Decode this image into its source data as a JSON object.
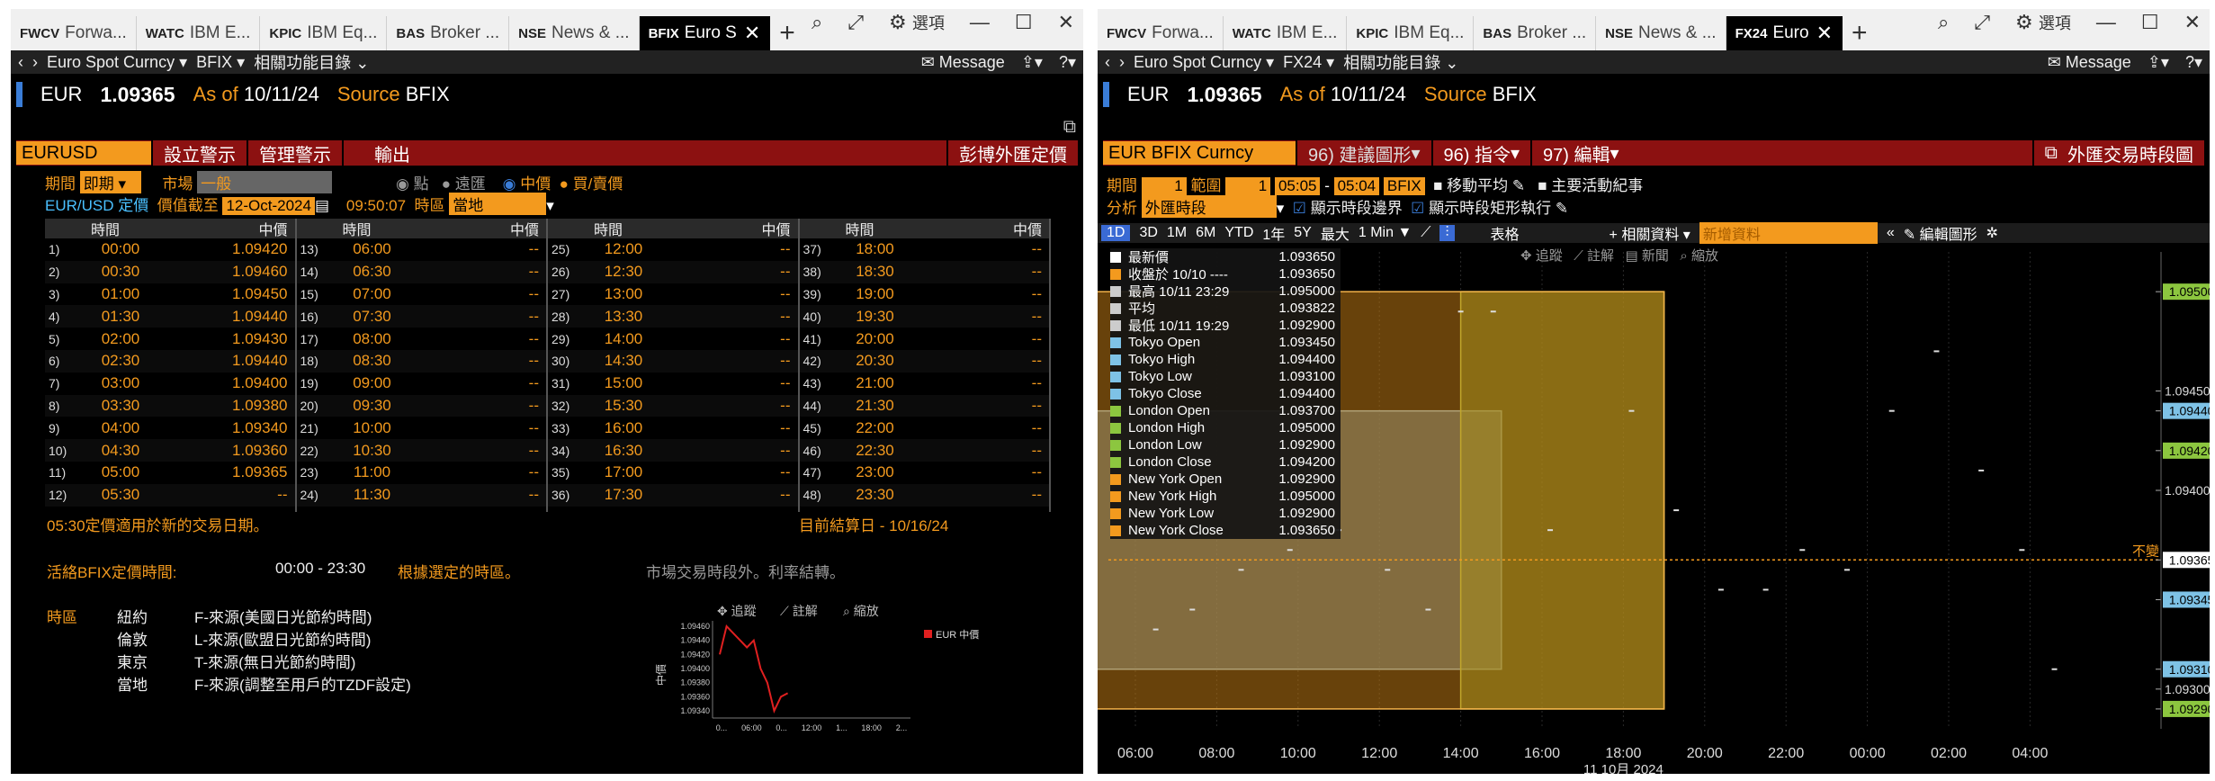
{
  "p1": {
    "tabs": [
      {
        "code": "FWCV",
        "name": "Forwa..."
      },
      {
        "code": "WATC",
        "name": "IBM E..."
      },
      {
        "code": "KPIC",
        "name": "IBM Eq..."
      },
      {
        "code": "BAS",
        "name": "Broker ..."
      },
      {
        "code": "NSE",
        "name": "News & ..."
      },
      {
        "code": "BFIX",
        "name": "Euro S"
      }
    ],
    "options_label": "選項",
    "nav": {
      "security": "Euro Spot Curncy",
      "func": "BFIX",
      "related": "相關功能目錄",
      "message": "Message"
    },
    "ticker": {
      "sym": "EUR",
      "price": "1.09365",
      "asof_label": "As of",
      "asof": "10/11/24",
      "source_label": "Source",
      "source": "BFIX"
    },
    "menu": {
      "sel": "EURUSD",
      "set_alert": "設立警示",
      "manage_alert": "管理警示",
      "export": "輸出",
      "title": "彭博外匯定價"
    },
    "ctrl": {
      "period_label": "期間",
      "period": "即期",
      "market_label": "市場",
      "market": "一般",
      "opt_spot": "點",
      "opt_far": "遠匯",
      "opt_mid": "中價",
      "opt_bidask": "買/賣價",
      "pair": "EUR/USD",
      "fix_label": "定價",
      "price_to_label": "價值截至",
      "date": "12-Oct-2024",
      "time": "09:50:07",
      "tz_label": "時區",
      "tz": "當地"
    },
    "cols": {
      "time": "時間",
      "mid": "中價"
    },
    "rows": [
      {
        "n": "1)",
        "t": "00:00",
        "v": "1.09420"
      },
      {
        "n": "2)",
        "t": "00:30",
        "v": "1.09460"
      },
      {
        "n": "3)",
        "t": "01:00",
        "v": "1.09450"
      },
      {
        "n": "4)",
        "t": "01:30",
        "v": "1.09440"
      },
      {
        "n": "5)",
        "t": "02:00",
        "v": "1.09430"
      },
      {
        "n": "6)",
        "t": "02:30",
        "v": "1.09440"
      },
      {
        "n": "7)",
        "t": "03:00",
        "v": "1.09400"
      },
      {
        "n": "8)",
        "t": "03:30",
        "v": "1.09380"
      },
      {
        "n": "9)",
        "t": "04:00",
        "v": "1.09340"
      },
      {
        "n": "10)",
        "t": "04:30",
        "v": "1.09360"
      },
      {
        "n": "11)",
        "t": "05:00",
        "v": "1.09365"
      },
      {
        "n": "12)",
        "t": "05:30",
        "v": "--"
      },
      {
        "n": "13)",
        "t": "06:00",
        "v": "--"
      },
      {
        "n": "14)",
        "t": "06:30",
        "v": "--"
      },
      {
        "n": "15)",
        "t": "07:00",
        "v": "--"
      },
      {
        "n": "16)",
        "t": "07:30",
        "v": "--"
      },
      {
        "n": "17)",
        "t": "08:00",
        "v": "--"
      },
      {
        "n": "18)",
        "t": "08:30",
        "v": "--"
      },
      {
        "n": "19)",
        "t": "09:00",
        "v": "--"
      },
      {
        "n": "20)",
        "t": "09:30",
        "v": "--"
      },
      {
        "n": "21)",
        "t": "10:00",
        "v": "--"
      },
      {
        "n": "22)",
        "t": "10:30",
        "v": "--"
      },
      {
        "n": "23)",
        "t": "11:00",
        "v": "--"
      },
      {
        "n": "24)",
        "t": "11:30",
        "v": "--"
      },
      {
        "n": "25)",
        "t": "12:00",
        "v": "--"
      },
      {
        "n": "26)",
        "t": "12:30",
        "v": "--"
      },
      {
        "n": "27)",
        "t": "13:00",
        "v": "--"
      },
      {
        "n": "28)",
        "t": "13:30",
        "v": "--"
      },
      {
        "n": "29)",
        "t": "14:00",
        "v": "--"
      },
      {
        "n": "30)",
        "t": "14:30",
        "v": "--"
      },
      {
        "n": "31)",
        "t": "15:00",
        "v": "--"
      },
      {
        "n": "32)",
        "t": "15:30",
        "v": "--"
      },
      {
        "n": "33)",
        "t": "16:00",
        "v": "--"
      },
      {
        "n": "34)",
        "t": "16:30",
        "v": "--"
      },
      {
        "n": "35)",
        "t": "17:00",
        "v": "--"
      },
      {
        "n": "36)",
        "t": "17:30",
        "v": "--"
      },
      {
        "n": "37)",
        "t": "18:00",
        "v": "--"
      },
      {
        "n": "38)",
        "t": "18:30",
        "v": "--"
      },
      {
        "n": "39)",
        "t": "19:00",
        "v": "--"
      },
      {
        "n": "40)",
        "t": "19:30",
        "v": "--"
      },
      {
        "n": "41)",
        "t": "20:00",
        "v": "--"
      },
      {
        "n": "42)",
        "t": "20:30",
        "v": "--"
      },
      {
        "n": "43)",
        "t": "21:00",
        "v": "--"
      },
      {
        "n": "44)",
        "t": "21:30",
        "v": "--"
      },
      {
        "n": "45)",
        "t": "22:00",
        "v": "--"
      },
      {
        "n": "46)",
        "t": "22:30",
        "v": "--"
      },
      {
        "n": "47)",
        "t": "23:00",
        "v": "--"
      },
      {
        "n": "48)",
        "t": "23:30",
        "v": "--"
      }
    ],
    "note": "05:30定價適用於新的交易日期。",
    "settle_label": "目前結算日 -",
    "settle": "10/16/24",
    "active_label": "活絡BFIX定價時間:",
    "active_range": "00:00 - 23:30",
    "active_note": "根據選定的時區。",
    "closed_note": "市場交易時段外。利率結轉。",
    "tz_head": "時區",
    "tz_list": [
      {
        "city": "紐約",
        "desc": "F-來源(美國日光節約時間)"
      },
      {
        "city": "倫敦",
        "desc": "L-來源(歐盟日光節約時間)"
      },
      {
        "city": "東京",
        "desc": "T-來源(無日光節約時間)"
      },
      {
        "city": "當地",
        "desc": "F-來源(調整至用戶的TZDF設定)"
      }
    ],
    "mini": {
      "track": "追蹤",
      "annot": "註解",
      "zoom": "縮放",
      "legend": "EUR 中價",
      "ylabel": "中價",
      "yticks": [
        "1.09460",
        "1.09440",
        "1.09420",
        "1.09400",
        "1.09380",
        "1.09360",
        "1.09340"
      ],
      "xticks": [
        "0...",
        "06:00",
        "0...",
        "12:00",
        "1...",
        "18:00",
        "2..."
      ]
    }
  },
  "p2": {
    "tabs": [
      {
        "code": "FWCV",
        "name": "Forwa..."
      },
      {
        "code": "WATC",
        "name": "IBM E..."
      },
      {
        "code": "KPIC",
        "name": "IBM Eq..."
      },
      {
        "code": "BAS",
        "name": "Broker ..."
      },
      {
        "code": "NSE",
        "name": "News & ..."
      },
      {
        "code": "FX24",
        "name": "Euro"
      }
    ],
    "options_label": "選項",
    "nav": {
      "security": "Euro Spot Curncy",
      "func": "FX24",
      "related": "相關功能目錄",
      "message": "Message"
    },
    "ticker": {
      "sym": "EUR",
      "price": "1.09365",
      "asof_label": "As of",
      "asof": "10/11/24",
      "source_label": "Source",
      "source": "BFIX"
    },
    "menu": {
      "sel": "EUR BFIX Curncy",
      "m1": "96) 建議圖形",
      "m2": "96) 指令",
      "m3": "97) 編輯",
      "title": "外匯交易時段圖"
    },
    "ctrl": {
      "period_label": "期間",
      "period": "1",
      "range_label": "範圍",
      "range": "1",
      "t1": "05:05",
      "t2": "05:04",
      "src": "BFIX",
      "ma": "移動平均",
      "events": "主要活動紀事",
      "analysis_label": "分析",
      "analysis": "外匯時段",
      "show_bounds": "顯示時段邊界",
      "show_rect": "顯示時段矩形執行"
    },
    "toolbar": {
      "ranges": [
        "1D",
        "3D",
        "1M",
        "6M",
        "YTD",
        "1年",
        "5Y",
        "最大"
      ],
      "interval": "1 Min",
      "table": "表格",
      "related": "相關資料",
      "new_data": "新增資料",
      "edit": "編輯圖形"
    },
    "chart_tools": {
      "track": "追蹤",
      "annot": "註解",
      "news": "新聞",
      "zoom": "縮放"
    },
    "legend": [
      {
        "label": "最新價",
        "val": "1.093650",
        "color": "#ffffff"
      },
      {
        "label": "收盤於 10/10 ----",
        "val": "1.093650",
        "color": "#f39a1e"
      },
      {
        "label": "最高 10/11 23:29",
        "val": "1.095000",
        "color": "#cccccc"
      },
      {
        "label": "平均",
        "val": "1.093822",
        "color": "#cccccc"
      },
      {
        "label": "最低 10/11 19:29",
        "val": "1.092900",
        "color": "#cccccc"
      },
      {
        "label": "Tokyo Open",
        "val": "1.093450",
        "color": "#7ec2e6"
      },
      {
        "label": "Tokyo High",
        "val": "1.094400",
        "color": "#7ec2e6"
      },
      {
        "label": "Tokyo Low",
        "val": "1.093100",
        "color": "#7ec2e6"
      },
      {
        "label": "Tokyo Close",
        "val": "1.094400",
        "color": "#7ec2e6"
      },
      {
        "label": "London Open",
        "val": "1.093700",
        "color": "#8cc63f"
      },
      {
        "label": "London High",
        "val": "1.095000",
        "color": "#8cc63f"
      },
      {
        "label": "London Low",
        "val": "1.092900",
        "color": "#8cc63f"
      },
      {
        "label": "London Close",
        "val": "1.094200",
        "color": "#8cc63f"
      },
      {
        "label": "New York Open",
        "val": "1.092900",
        "color": "#f39a1e"
      },
      {
        "label": "New York High",
        "val": "1.095000",
        "color": "#f39a1e"
      },
      {
        "label": "New York Low",
        "val": "1.092900",
        "color": "#f39a1e"
      },
      {
        "label": "New York Close",
        "val": "1.093650",
        "color": "#f39a1e"
      }
    ],
    "right_ticks": [
      "1.095000",
      "1.094500",
      "1.094400",
      "1.094200",
      "1.094000",
      "1.093650",
      "1.093450",
      "1.093100",
      "1.093000",
      "1.092900"
    ],
    "x_ticks": [
      "06:00",
      "08:00",
      "10:00",
      "12:00",
      "14:00",
      "16:00",
      "18:00",
      "20:00",
      "22:00",
      "00:00",
      "02:00",
      "04:00"
    ],
    "x_date": "11 10月 2024",
    "overlay_text": "不變"
  },
  "chart_data": [
    {
      "type": "line",
      "title": "",
      "ylabel": "中價",
      "series": [
        {
          "name": "EUR 中價",
          "x": [
            "00:00",
            "00:30",
            "01:00",
            "01:30",
            "02:00",
            "02:30",
            "03:00",
            "03:30",
            "04:00",
            "04:30",
            "05:00"
          ],
          "values": [
            1.0942,
            1.0946,
            1.0945,
            1.0944,
            1.0943,
            1.0944,
            1.094,
            1.0938,
            1.0934,
            1.0936,
            1.09365
          ]
        }
      ],
      "ylim": [
        1.0934,
        1.0946
      ]
    },
    {
      "type": "line",
      "title": "",
      "xlabel": "11 10月 2024",
      "ylim": [
        1.0928,
        1.0952
      ],
      "sessions": [
        {
          "name": "Tokyo",
          "start": "05:00",
          "end": "15:00",
          "open": 1.09345,
          "high": 1.0944,
          "low": 1.0931,
          "close": 1.0944
        },
        {
          "name": "London",
          "start": "14:00",
          "end": "19:00",
          "open": 1.0937,
          "high": 1.095,
          "low": 1.0929,
          "close": 1.0942
        },
        {
          "name": "New York",
          "start": "19:00",
          "end": "05:00",
          "open": 1.0929,
          "high": 1.095,
          "low": 1.0929,
          "close": 1.09365
        }
      ],
      "last": 1.09365
    }
  ]
}
